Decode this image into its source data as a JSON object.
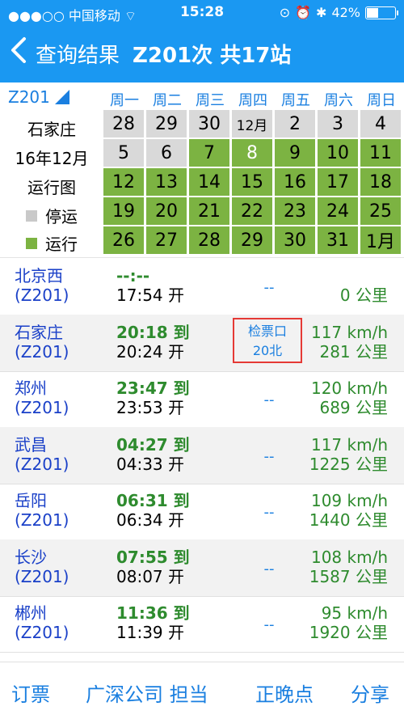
{
  "status_bar": {
    "carrier": "中国移动",
    "time": "15:28",
    "battery": "42%"
  },
  "nav": {
    "title": "查询结果",
    "train_info": "Z201次 共17站"
  },
  "calendar": {
    "train": "Z201",
    "station": "石家庄",
    "month_label": "16年12月",
    "map_label": "运行图",
    "legend": {
      "stopped": "停运",
      "running": "运行"
    },
    "weekdays": [
      "周一",
      "周二",
      "周三",
      "周四",
      "周五",
      "周六",
      "周日"
    ],
    "rows": [
      [
        {
          "v": "28",
          "s": "gray"
        },
        {
          "v": "29",
          "s": "gray"
        },
        {
          "v": "30",
          "s": "gray"
        },
        {
          "v": "12月",
          "s": "gray"
        },
        {
          "v": "2",
          "s": "gray"
        },
        {
          "v": "3",
          "s": "gray"
        },
        {
          "v": "4",
          "s": "gray"
        }
      ],
      [
        {
          "v": "5",
          "s": "gray"
        },
        {
          "v": "6",
          "s": "gray"
        },
        {
          "v": "7",
          "s": "green"
        },
        {
          "v": "8",
          "s": "green",
          "today": true
        },
        {
          "v": "9",
          "s": "green"
        },
        {
          "v": "10",
          "s": "green"
        },
        {
          "v": "11",
          "s": "green"
        }
      ],
      [
        {
          "v": "12",
          "s": "green"
        },
        {
          "v": "13",
          "s": "green"
        },
        {
          "v": "14",
          "s": "green"
        },
        {
          "v": "15",
          "s": "green"
        },
        {
          "v": "16",
          "s": "green"
        },
        {
          "v": "17",
          "s": "green"
        },
        {
          "v": "18",
          "s": "green"
        }
      ],
      [
        {
          "v": "19",
          "s": "green"
        },
        {
          "v": "20",
          "s": "green"
        },
        {
          "v": "21",
          "s": "green"
        },
        {
          "v": "22",
          "s": "green"
        },
        {
          "v": "23",
          "s": "green"
        },
        {
          "v": "24",
          "s": "green"
        },
        {
          "v": "25",
          "s": "green"
        }
      ],
      [
        {
          "v": "26",
          "s": "green"
        },
        {
          "v": "27",
          "s": "green"
        },
        {
          "v": "28",
          "s": "green"
        },
        {
          "v": "29",
          "s": "green"
        },
        {
          "v": "30",
          "s": "green"
        },
        {
          "v": "31",
          "s": "green"
        },
        {
          "v": "1月",
          "s": "green"
        }
      ]
    ]
  },
  "stations": [
    {
      "name": "北京西",
      "code": "(Z201)",
      "arrive": "--:--",
      "depart": "17:54 开",
      "gate": "--",
      "speed": "",
      "distance": "0 公里"
    },
    {
      "name": "石家庄",
      "code": "(Z201)",
      "arrive": "20:18 到",
      "depart": "20:24 开",
      "gate": "检票口\n20北",
      "ticket": true,
      "speed": "117 km/h",
      "distance": "281 公里"
    },
    {
      "name": "郑州",
      "code": "(Z201)",
      "arrive": "23:47 到",
      "depart": "23:53 开",
      "gate": "--",
      "speed": "120 km/h",
      "distance": "689 公里"
    },
    {
      "name": "武昌",
      "code": "(Z201)",
      "arrive": "04:27 到",
      "depart": "04:33 开",
      "gate": "--",
      "speed": "117 km/h",
      "distance": "1225 公里"
    },
    {
      "name": "岳阳",
      "code": "(Z201)",
      "arrive": "06:31 到",
      "depart": "06:34 开",
      "gate": "--",
      "speed": "109 km/h",
      "distance": "1440 公里"
    },
    {
      "name": "长沙",
      "code": "(Z201)",
      "arrive": "07:55 到",
      "depart": "08:07 开",
      "gate": "--",
      "speed": "108 km/h",
      "distance": "1587 公里"
    },
    {
      "name": "郴州",
      "code": "(Z201)",
      "arrive": "11:36 到",
      "depart": "11:39 开",
      "gate": "--",
      "speed": "95 km/h",
      "distance": "1920 公里"
    }
  ],
  "bottom_bar": {
    "book": "订票",
    "company": "广深公司 担当",
    "on_time": "正晚点",
    "share": "分享"
  }
}
